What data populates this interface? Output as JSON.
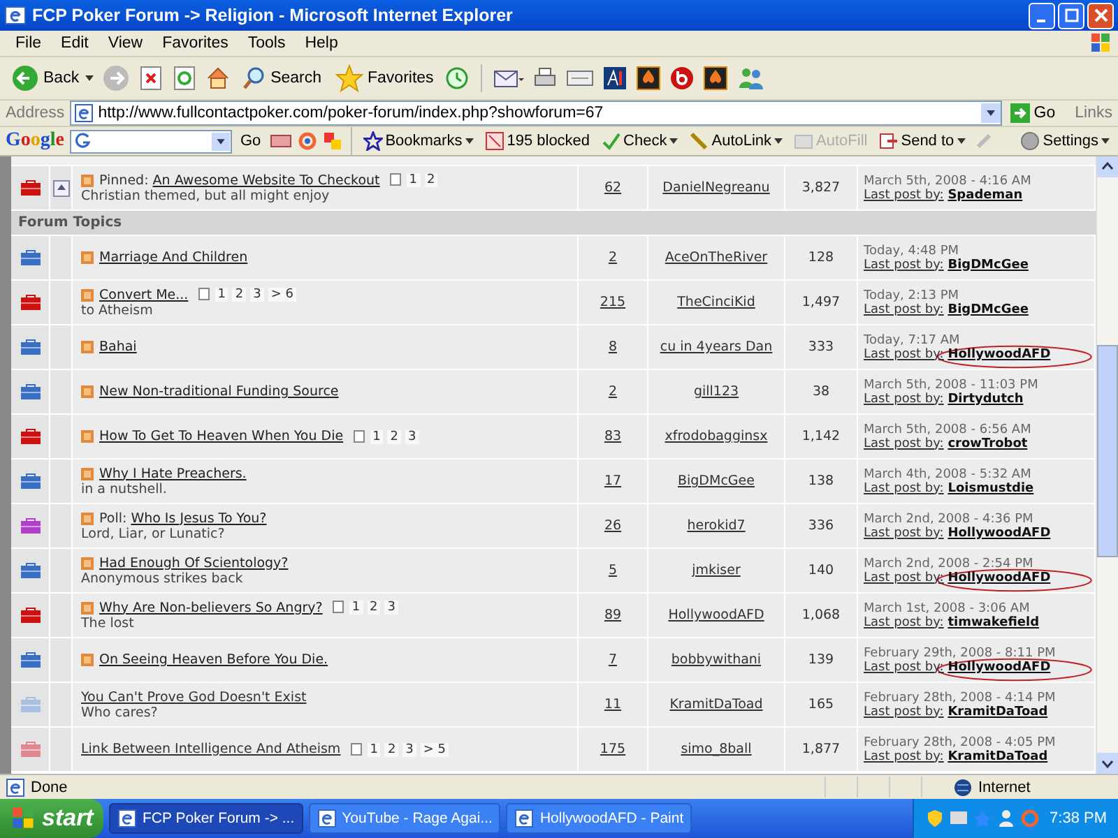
{
  "window": {
    "title": "FCP Poker Forum -> Religion - Microsoft Internet Explorer"
  },
  "menu": [
    "File",
    "Edit",
    "View",
    "Favorites",
    "Tools",
    "Help"
  ],
  "toolbar": {
    "back": "Back",
    "search": "Search",
    "favorites": "Favorites"
  },
  "address": {
    "label": "Address",
    "url": "http://www.fullcontactpoker.com/poker-forum/index.php?showforum=67",
    "go": "Go",
    "links": "Links"
  },
  "google_bar": {
    "logo": "Google",
    "go": "Go",
    "bookmarks": "Bookmarks",
    "blocked": "195 blocked",
    "check": "Check",
    "autolink": "AutoLink",
    "autofill": {
      "label": "AutoFill",
      "disabled": true
    },
    "send_to": "Send to",
    "settings": "Settings"
  },
  "rows": [
    {
      "kind": "thread",
      "color": "#cc1111",
      "sticky": true,
      "new_post": true,
      "prefix": "Pinned:",
      "title": "An Awesome Website To Checkout",
      "subtitle": "Christian themed, but all might enjoy",
      "pages": [
        "1",
        "2"
      ],
      "replies": "62",
      "author": "DanielNegreanu",
      "views": "3,827",
      "date": "March 5th, 2008 - 4:16 AM",
      "by": "Last post by:",
      "user": "Spademan",
      "circled": false
    },
    {
      "kind": "section",
      "title": "Forum Topics"
    },
    {
      "kind": "thread",
      "color": "#3a6fc4",
      "sticky": false,
      "new_post": true,
      "title": "Marriage And Children",
      "replies": "2",
      "author": "AceOnTheRiver",
      "views": "128",
      "date": "Today, 4:48 PM",
      "by": "Last post by:",
      "user": "BigDMcGee",
      "circled": false
    },
    {
      "kind": "thread",
      "color": "#cc1111",
      "sticky": false,
      "new_post": true,
      "title": "Convert Me...",
      "subtitle": "to Atheism",
      "pages": [
        "1",
        "2",
        "3",
        "> 6"
      ],
      "replies": "215",
      "author": "TheCinciKid",
      "views": "1,497",
      "date": "Today, 2:13 PM",
      "by": "Last post by:",
      "user": "BigDMcGee",
      "circled": false
    },
    {
      "kind": "thread",
      "color": "#3a6fc4",
      "sticky": false,
      "new_post": true,
      "title": "Bahai",
      "replies": "8",
      "author": "cu in 4years Dan",
      "views": "333",
      "date": "Today, 7:17 AM",
      "by": "Last post by:",
      "user": "HollywoodAFD",
      "circled": true
    },
    {
      "kind": "thread",
      "color": "#3a6fc4",
      "sticky": false,
      "new_post": true,
      "title": "New Non-traditional Funding Source",
      "replies": "2",
      "author": "gill123",
      "views": "38",
      "date": "March 5th, 2008 - 11:03 PM",
      "by": "Last post by:",
      "user": "Dirtydutch",
      "circled": false
    },
    {
      "kind": "thread",
      "color": "#cc1111",
      "sticky": false,
      "new_post": true,
      "title": "How To Get To Heaven When You Die",
      "pages": [
        "1",
        "2",
        "3"
      ],
      "replies": "83",
      "author": "xfrodobagginsx",
      "views": "1,142",
      "date": "March 5th, 2008 - 6:56 AM",
      "by": "Last post by:",
      "user": "crowTrobot",
      "circled": false
    },
    {
      "kind": "thread",
      "color": "#3a6fc4",
      "sticky": false,
      "new_post": true,
      "title": "Why I Hate Preachers.",
      "subtitle": "in a nutshell.",
      "replies": "17",
      "author": "BigDMcGee",
      "views": "138",
      "date": "March 4th, 2008 - 5:32 AM",
      "by": "Last post by:",
      "user": "Loismustdie",
      "circled": false
    },
    {
      "kind": "thread",
      "color": "#b040c8",
      "sticky": false,
      "new_post": true,
      "prefix": "Poll:",
      "title": "Who Is Jesus To You?",
      "subtitle": "Lord, Liar, or Lunatic?",
      "replies": "26",
      "author": "herokid7",
      "views": "336",
      "date": "March 2nd, 2008 - 4:36 PM",
      "by": "Last post by:",
      "user": "HollywoodAFD",
      "circled": false
    },
    {
      "kind": "thread",
      "color": "#3a6fc4",
      "sticky": false,
      "new_post": true,
      "title": "Had Enough Of Scientology?",
      "subtitle": "Anonymous strikes back",
      "replies": "5",
      "author": "jmkiser",
      "views": "140",
      "date": "March 2nd, 2008 - 2:54 PM",
      "by": "Last post by:",
      "user": "HollywoodAFD",
      "circled": true
    },
    {
      "kind": "thread",
      "color": "#cc1111",
      "sticky": false,
      "new_post": true,
      "title": "Why Are Non-believers So Angry?",
      "subtitle": "The lost",
      "pages": [
        "1",
        "2",
        "3"
      ],
      "replies": "89",
      "author": "HollywoodAFD",
      "views": "1,068",
      "date": "March 1st, 2008 - 3:06 AM",
      "by": "Last post by:",
      "user": "timwakefield",
      "circled": false
    },
    {
      "kind": "thread",
      "color": "#3a6fc4",
      "sticky": false,
      "new_post": true,
      "title": "On Seeing Heaven Before You Die.",
      "replies": "7",
      "author": "bobbywithani",
      "views": "139",
      "date": "February 29th, 2008 - 8:11 PM",
      "by": "Last post by:",
      "user": "HollywoodAFD",
      "circled": true
    },
    {
      "kind": "thread",
      "color": "#a9bfe0",
      "sticky": false,
      "new_post": false,
      "title": "You Can't Prove God Doesn't Exist",
      "subtitle": "Who cares?",
      "replies": "11",
      "author": "KramitDaToad",
      "views": "165",
      "date": "February 28th, 2008 - 4:14 PM",
      "by": "Last post by:",
      "user": "KramitDaToad",
      "circled": false
    },
    {
      "kind": "thread",
      "color": "#e08890",
      "sticky": false,
      "new_post": false,
      "title": "Link Between Intelligence And Atheism",
      "pages": [
        "1",
        "2",
        "3",
        "> 5"
      ],
      "replies": "175",
      "author": "simo_8ball",
      "views": "1,877",
      "date": "February 28th, 2008 - 4:05 PM",
      "by": "Last post by:",
      "user": "KramitDaToad",
      "circled": false
    }
  ],
  "status_bar": {
    "text": "Done",
    "zone": "Internet"
  },
  "taskbar": {
    "start": "start",
    "tasks": [
      {
        "label": "FCP Poker Forum -> ...",
        "selected": true
      },
      {
        "label": "YouTube - Rage Agai...",
        "selected": false
      },
      {
        "label": "HollywoodAFD - Paint",
        "selected": false
      }
    ],
    "clock": "7:38 PM"
  }
}
